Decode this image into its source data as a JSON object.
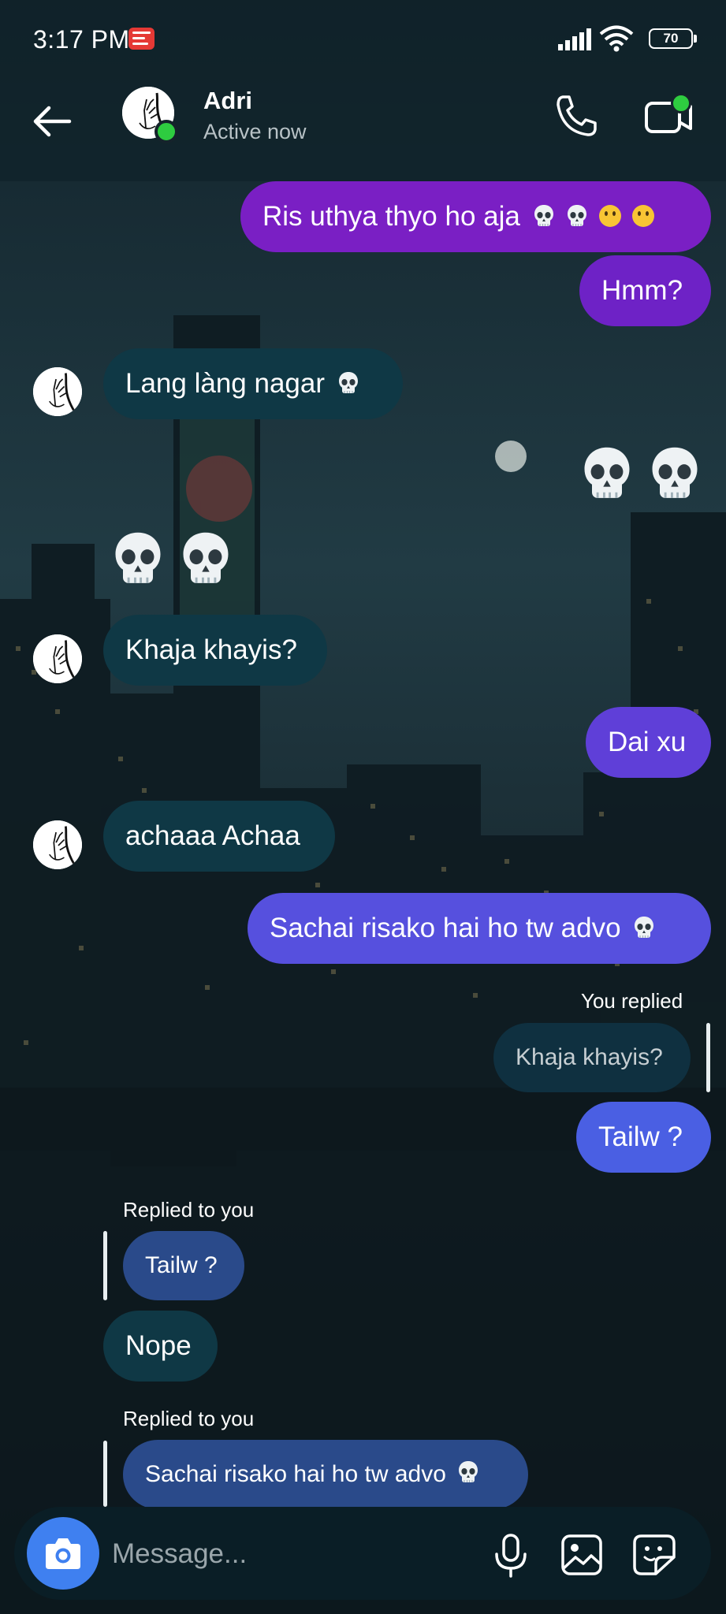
{
  "status_bar": {
    "time": "3:17 PM",
    "battery": "70"
  },
  "header": {
    "name": "Adri",
    "status": "Active now"
  },
  "messages": {
    "m1": "Ris uthya thyo ho aja",
    "m2": "Hmm?",
    "m3": "Lang làng nagar",
    "m4": "Khaja khayis?",
    "m5": "Dai xu",
    "m6": "achaaa Achaa",
    "m7": "Sachai risako hai ho tw advo",
    "m8_label": "You replied",
    "m8_quote": "Khaja khayis?",
    "m8": "Tailw ?",
    "m9_label": "Replied to you",
    "m9_quote": "Tailw ?",
    "m9": "Nope",
    "m10_label": "Replied to you",
    "m10_quote": "Sachai risako hai ho tw advo"
  },
  "composer": {
    "placeholder": "Message..."
  },
  "colors": {
    "outgoing_gradient_top": "#7a1fc4",
    "outgoing_gradient_bottom": "#4a5fe3",
    "incoming": "#0f3845",
    "online": "#2ecc40",
    "camera": "#3f80f0"
  },
  "icons": [
    "back-arrow-icon",
    "phone-icon",
    "video-camera-icon",
    "skull-emoji",
    "neutral-face-emoji",
    "camera-icon",
    "microphone-icon",
    "gallery-icon",
    "sticker-icon"
  ]
}
